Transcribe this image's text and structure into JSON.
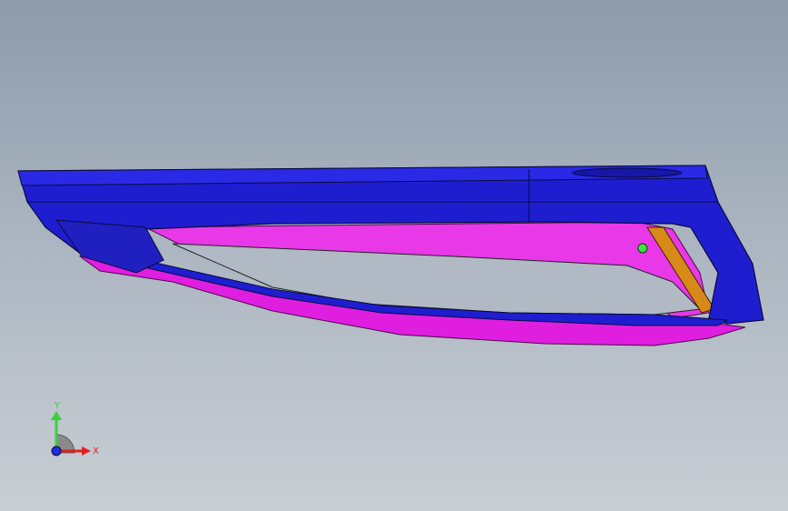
{
  "viewport": {
    "background_top": "#8e9bab",
    "background_bottom": "#c9ced4"
  },
  "model": {
    "colors": {
      "primary_part": "#1e1ed0",
      "secondary_part": "#e01ee0",
      "accent_strip": "#d88a18",
      "hole_marker": "#3ce63c",
      "edge_line": "#0a0a40"
    }
  },
  "triad": {
    "y_label": "Y",
    "x_label": "X",
    "y_color": "#3ccf3c",
    "x_color": "#e02020",
    "z_color": "#1e2ee0"
  }
}
